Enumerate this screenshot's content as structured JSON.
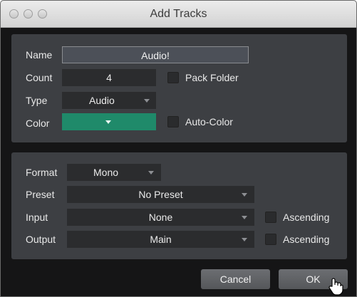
{
  "window": {
    "title": "Add Tracks"
  },
  "track": {
    "name_label": "Name",
    "name_value": "Audio!",
    "count_label": "Count",
    "count_value": "4",
    "pack_folder_label": "Pack Folder",
    "type_label": "Type",
    "type_value": "Audio",
    "color_label": "Color",
    "color_value": "#1f8a6a",
    "auto_color_label": "Auto-Color"
  },
  "io": {
    "format_label": "Format",
    "format_value": "Mono",
    "preset_label": "Preset",
    "preset_value": "No Preset",
    "input_label": "Input",
    "input_value": "None",
    "input_ascending_label": "Ascending",
    "output_label": "Output",
    "output_value": "Main",
    "output_ascending_label": "Ascending"
  },
  "buttons": {
    "cancel": "Cancel",
    "ok": "OK"
  }
}
